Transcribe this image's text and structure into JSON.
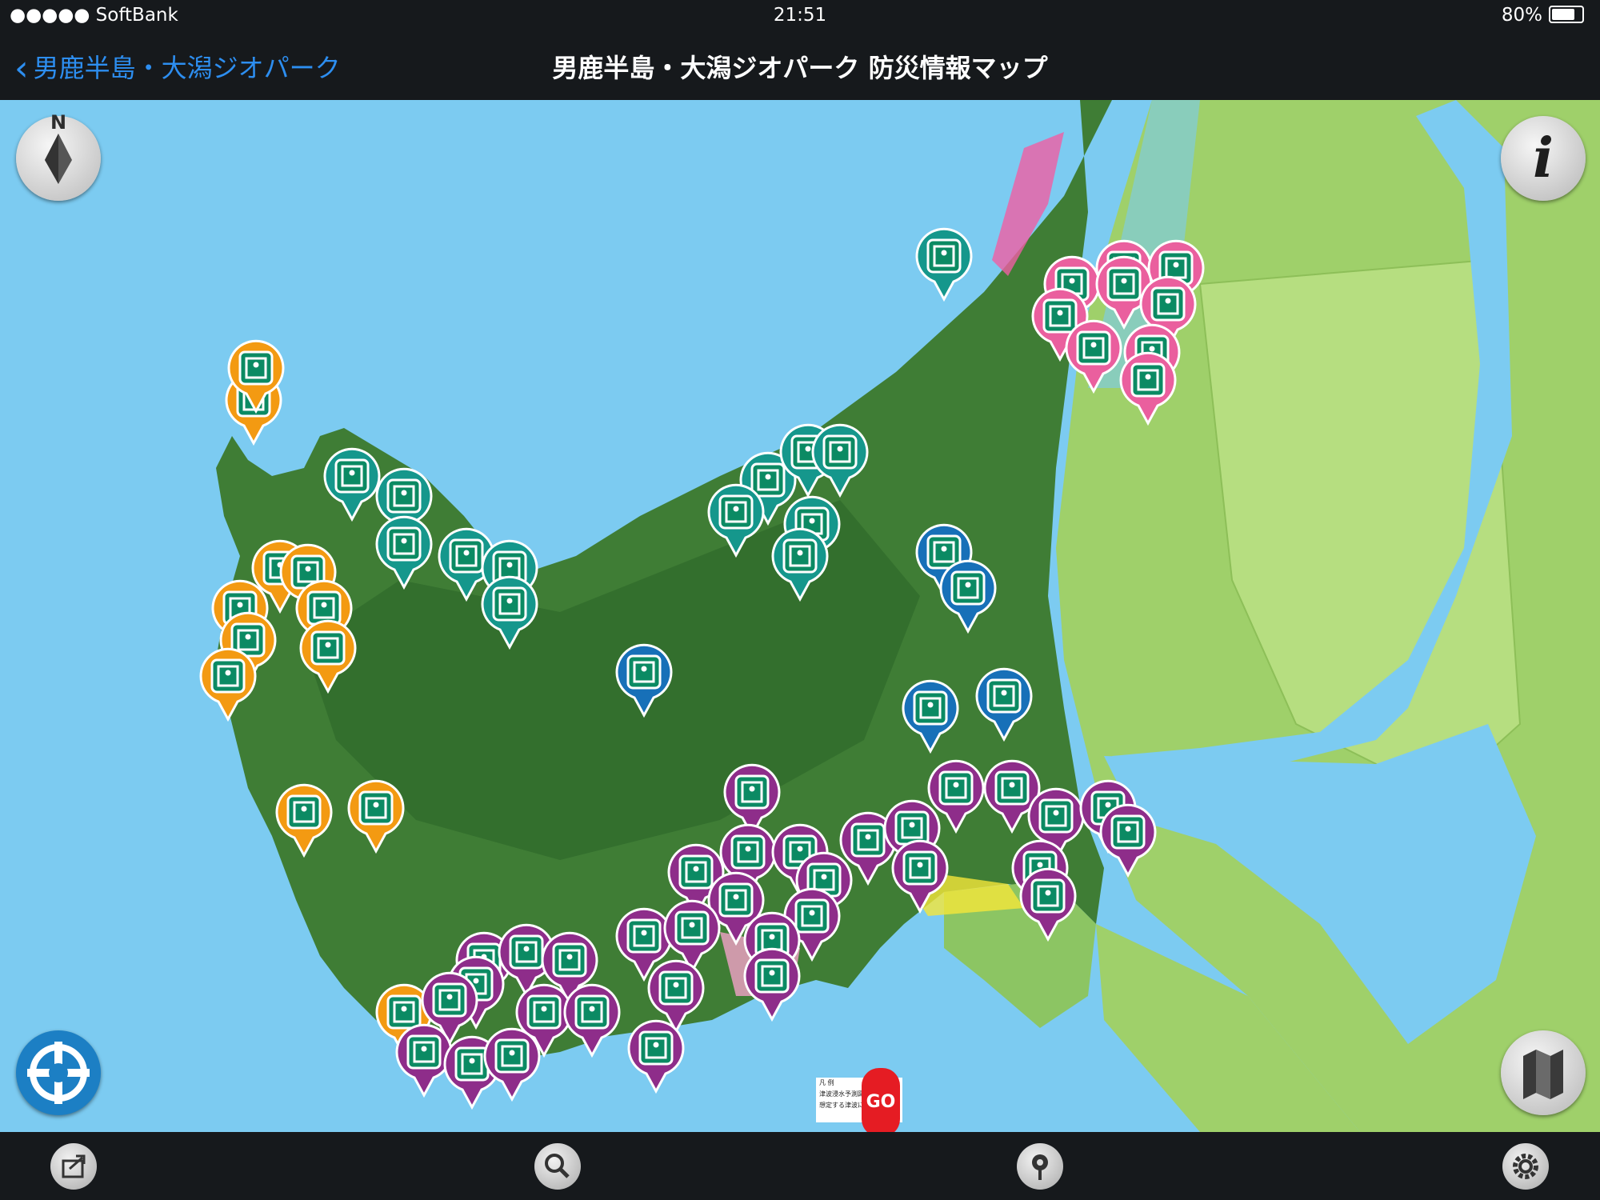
{
  "status_bar": {
    "carrier": "●●●●● SoftBank",
    "time": "21:51",
    "battery": "80%"
  },
  "nav": {
    "back_label": "男鹿半島・大潟ジオパーク",
    "title": "男鹿半島・大潟ジオパーク 防災情報マップ"
  },
  "map": {
    "compass_label": "N",
    "info_label": "i",
    "go_label": "GO",
    "legend_lines": [
      "凡 例",
      "津波浸水予測図の…",
      "想定する津波に…"
    ],
    "colors": {
      "sea": "#7ccbf1",
      "land": "#3f7d35",
      "paddy": "#a2d36b",
      "orange_pin": "#f39a12",
      "teal_pin": "#15978c",
      "blue_pin": "#1770b8",
      "pink_pin": "#ea5f9e",
      "purple_pin": "#8e2d8a",
      "icon_green": "#0b8a63"
    }
  }
}
